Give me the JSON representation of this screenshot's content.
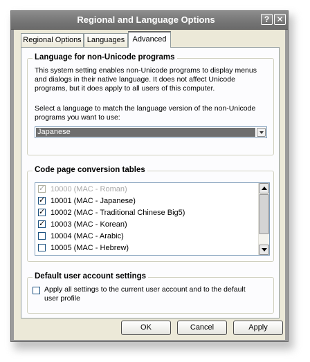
{
  "window": {
    "title": "Regional and Language Options",
    "help_label": "?",
    "close_label": "✕"
  },
  "tabs": [
    {
      "label": "Regional Options"
    },
    {
      "label": "Languages"
    },
    {
      "label": "Advanced"
    }
  ],
  "non_unicode": {
    "heading": "Language for non-Unicode programs",
    "desc1": [
      "This system setting enables non-Unicode programs to display menus",
      "and dialogs in their native language. It does not affect Unicode",
      "programs, but it does apply to all users of this computer."
    ],
    "desc2": [
      "Select a language to match the language version of the non-Unicode",
      "programs you want to use:"
    ],
    "selected_language": "Japanese"
  },
  "code_pages": {
    "heading": "Code page conversion tables",
    "items": [
      {
        "label": "10000 (MAC - Roman)",
        "checked": true,
        "disabled": true
      },
      {
        "label": "10001 (MAC - Japanese)",
        "checked": true,
        "disabled": false
      },
      {
        "label": "10002 (MAC - Traditional Chinese Big5)",
        "checked": true,
        "disabled": false
      },
      {
        "label": "10003 (MAC - Korean)",
        "checked": true,
        "disabled": false
      },
      {
        "label": "10004 (MAC - Arabic)",
        "checked": false,
        "disabled": false
      },
      {
        "label": "10005 (MAC - Hebrew)",
        "checked": false,
        "disabled": false
      }
    ]
  },
  "default_user": {
    "heading": "Default user account settings",
    "checkbox_lines": [
      "Apply all settings to the current user account and to the default",
      "user profile"
    ],
    "checked": false
  },
  "buttons": {
    "ok": "OK",
    "cancel": "Cancel",
    "apply": "Apply"
  }
}
